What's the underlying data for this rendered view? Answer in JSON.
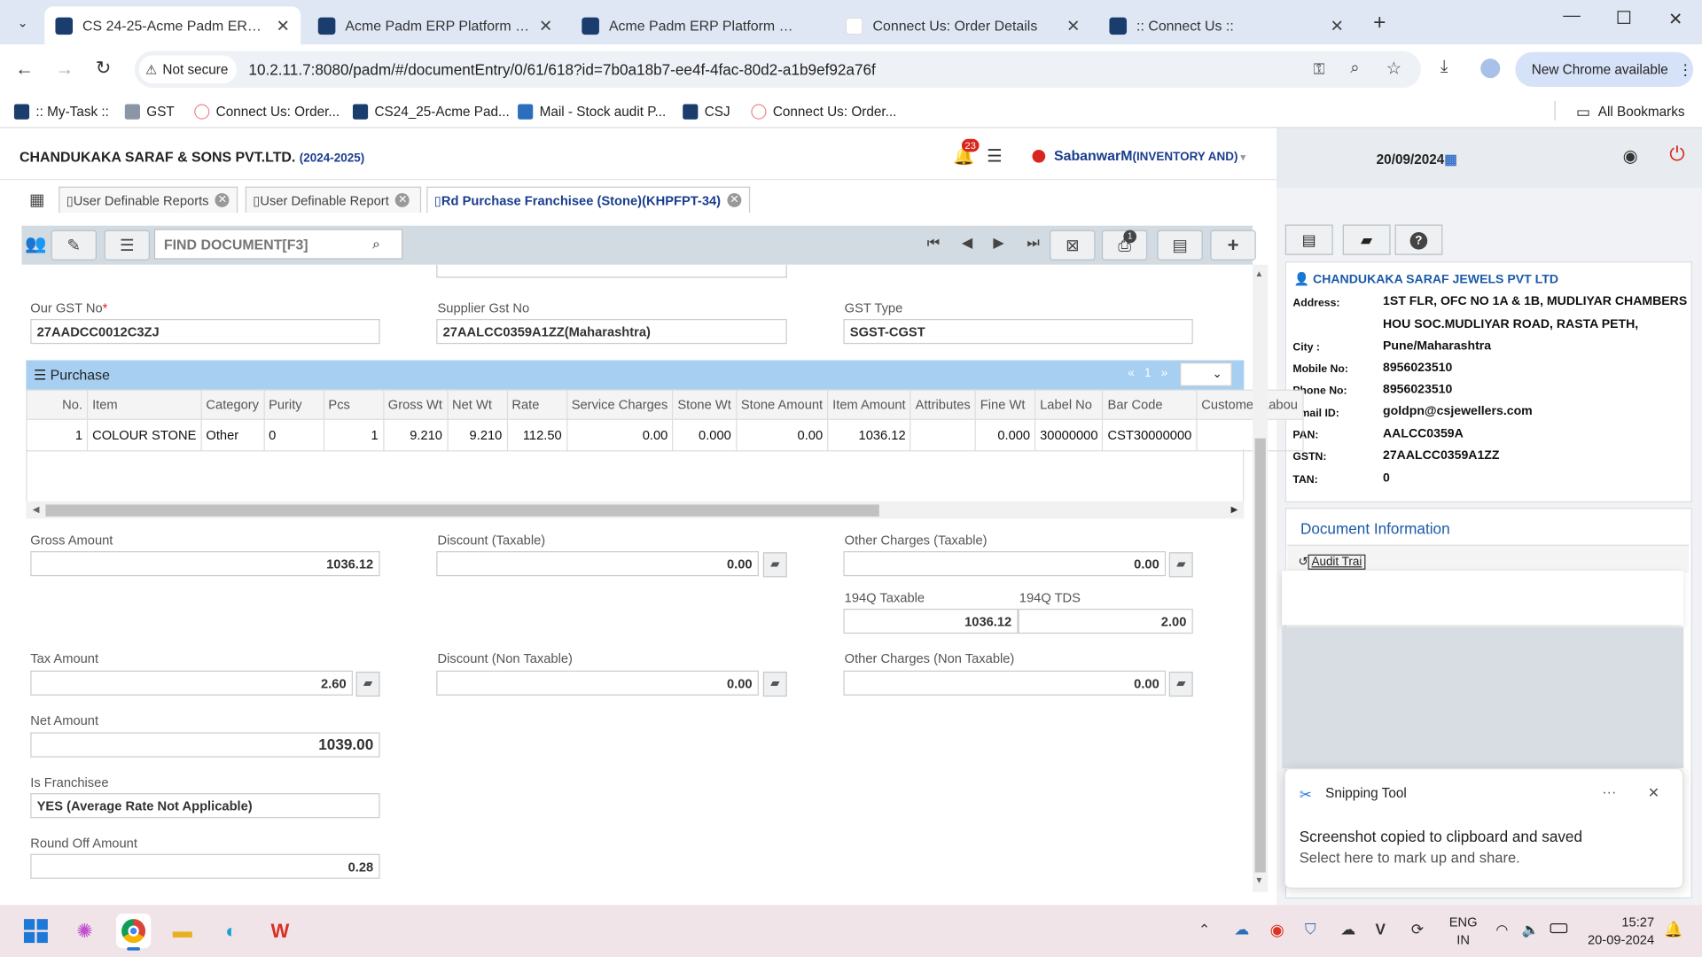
{
  "browser": {
    "tabs": [
      {
        "title": "CS 24-25-Acme Padm ERP Platf",
        "active": true
      },
      {
        "title": "Acme Padm ERP Platform 1.00"
      },
      {
        "title": "Acme Padm ERP Platform 1.00"
      },
      {
        "title": "Connect Us: Order Details"
      },
      {
        "title": ":: Connect Us ::"
      }
    ],
    "new_tab": "+",
    "security": "Not secure",
    "url": "10.2.11.7:8080/padm/#/documentEntry/0/61/618?id=7b0a18b7-ee4f-4fac-80d2-a1b9ef92a76f",
    "update_label": "New Chrome available",
    "bookmarks": [
      ":: My-Task ::",
      "GST",
      "Connect Us: Order...",
      "CS24_25-Acme Pad...",
      "Mail - Stock audit P...",
      "CSJ",
      "Connect Us: Order..."
    ],
    "all_bookmarks": "All Bookmarks"
  },
  "app": {
    "company": "CHANDUKAKA SARAF & SONS PVT.LTD.",
    "year": "(2024-2025)",
    "notif_count": "23",
    "user": "SabanwarM",
    "user_role": "(INVENTORY AND)",
    "date": "20/09/2024",
    "tabs": [
      "User Definable Reports",
      "User Definable Report",
      "Rd Purchase Franchisee (Stone)(KHPFPT-34)"
    ],
    "find_placeholder": "FIND DOCUMENT[F3]",
    "print_badge": "1"
  },
  "form": {
    "our_gst_label": "Our GST No",
    "our_gst": "27AADCC0012C3ZJ",
    "supplier_gst_label": "Supplier Gst No",
    "supplier_gst": "27AALCC0359A1ZZ(Maharashtra)",
    "gst_type_label": "GST Type",
    "gst_type": "SGST-CGST",
    "purchase_title": "Purchase",
    "pager_page": "1",
    "columns": [
      "No.",
      "Item",
      "Category",
      "Purity",
      "Pcs",
      "Gross Wt",
      "Net Wt",
      "Rate",
      "Service Charges",
      "Stone Wt",
      "Stone Amount",
      "Item Amount",
      "Attributes",
      "Fine Wt",
      "Label No",
      "Bar Code",
      "Customer Labou"
    ],
    "rows": [
      [
        "1",
        "COLOUR STONE",
        "Other",
        "0",
        "1",
        "9.210",
        "9.210",
        "112.50",
        "0.00",
        "0.000",
        "0.00",
        "1036.12",
        "",
        "0.000",
        "30000000",
        "CST30000000",
        ""
      ]
    ],
    "gross_amount_label": "Gross Amount",
    "gross_amount": "1036.12",
    "discount_taxable_label": "Discount (Taxable)",
    "discount_taxable": "0.00",
    "other_taxable_label": "Other Charges (Taxable)",
    "other_taxable": "0.00",
    "taxable_194q_label": "194Q Taxable",
    "taxable_194q": "1036.12",
    "tds_194q_label": "194Q TDS",
    "tds_194q": "2.00",
    "tax_amount_label": "Tax Amount",
    "tax_amount": "2.60",
    "discount_nontax_label": "Discount (Non Taxable)",
    "discount_nontax": "0.00",
    "other_nontax_label": "Other Charges (Non Taxable)",
    "other_nontax": "0.00",
    "net_amount_label": "Net Amount",
    "net_amount": "1039.00",
    "franchisee_label": "Is Franchisee",
    "franchisee": "YES (Average Rate Not Applicable)",
    "round_off_label": "Round Off Amount",
    "round_off": "0.28"
  },
  "party": {
    "name": "CHANDUKAKA SARAF JEWELS PVT LTD",
    "fields": [
      {
        "k": "Address:",
        "v": "1ST FLR, OFC NO 1A & 1B, MUDLIYAR CHAMBERS"
      },
      {
        "k": "",
        "v": "HOU SOC.MUDLIYAR ROAD, RASTA PETH,"
      },
      {
        "k": "City :",
        "v": "Pune/Maharashtra"
      },
      {
        "k": "Mobile No:",
        "v": "8956023510"
      },
      {
        "k": "Phone No:",
        "v": "8956023510"
      },
      {
        "k": "Email ID:",
        "v": "goldpn@csjewellers.com"
      },
      {
        "k": "PAN:",
        "v": "AALCC0359A"
      },
      {
        "k": "GSTN:",
        "v": "27AALCC0359A1ZZ"
      },
      {
        "k": "TAN:",
        "v": "0"
      }
    ],
    "doc_info_title": "Document Information",
    "audit_trail": "Audit Trai"
  },
  "snipping": {
    "app": "Snipping Tool",
    "title": "Screenshot copied to clipboard and saved",
    "sub": "Select here to mark up and share."
  },
  "taskbar": {
    "lang": "ENG",
    "lang2": "IN",
    "time": "15:27",
    "date": "20-09-2024"
  },
  "colors": {
    "accent": "#1a3d8d",
    "purchase_header": "#a7cff2",
    "toolbar": "#d2dbe1",
    "taskbar": "#f1e4e8",
    "power": "#d9261c"
  }
}
